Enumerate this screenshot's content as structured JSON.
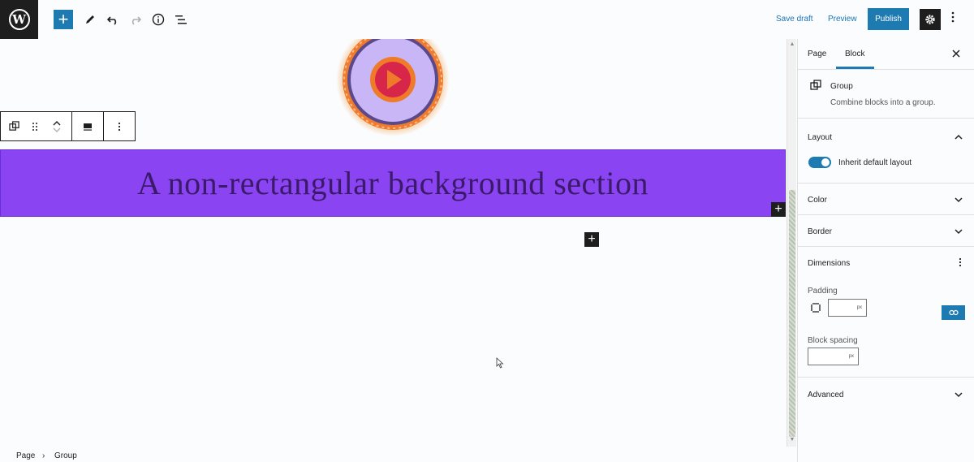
{
  "topbar": {
    "logo_letter": "W",
    "add_block": "+",
    "save_draft": "Save draft",
    "preview": "Preview",
    "publish": "Publish"
  },
  "canvas": {
    "group_heading": "A non-rectangular background section",
    "group_bg_color": "#8a44f2",
    "inserter_symbol": "+"
  },
  "sidebar": {
    "tabs": [
      {
        "label": "Page"
      },
      {
        "label": "Block"
      }
    ],
    "block": {
      "name": "Group",
      "description": "Combine blocks into a group."
    },
    "layout": {
      "title": "Layout",
      "toggle_label": "Inherit default layout",
      "toggle_on": true
    },
    "color": {
      "title": "Color"
    },
    "border": {
      "title": "Border"
    },
    "dimensions": {
      "title": "Dimensions",
      "padding_label": "Padding",
      "padding_unit": "px",
      "block_spacing_label": "Block spacing",
      "block_spacing_unit": "px"
    },
    "advanced": {
      "title": "Advanced"
    }
  },
  "breadcrumb": {
    "items": [
      "Page",
      "Group"
    ],
    "separator": "›"
  },
  "colors": {
    "accent": "#1e7bb2",
    "dark": "#1e1e1e"
  }
}
